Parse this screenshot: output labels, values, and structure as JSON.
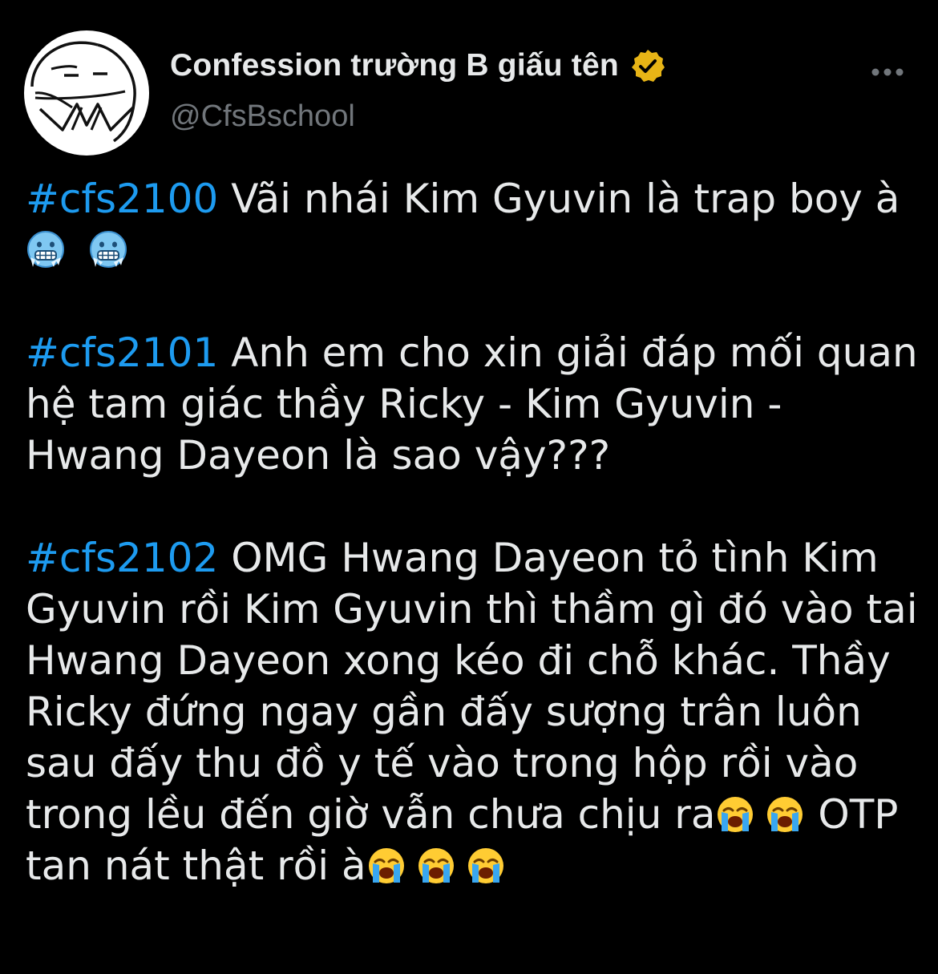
{
  "account": {
    "display_name": "Confession trường B giấu tên",
    "handle": "@CfsBschool",
    "verified_color": "#e7b416"
  },
  "tweet": {
    "posts": [
      {
        "tag": "#cfs2100",
        "text": "  Vãi nhái Kim Gyuvin là trap boy à",
        "emojis": [
          "cold-face",
          "cold-face"
        ]
      },
      {
        "tag": "#cfs2101",
        "text": "  Anh em cho xin giải đáp mối quan hệ tam giác thầy Ricky - Kim Gyuvin - Hwang Dayeon là sao vậy???"
      },
      {
        "tag": "#cfs2102",
        "text": "  OMG Hwang Dayeon tỏ tình Kim Gyuvin rồi Kim Gyuvin thì thầm gì đó vào tai Hwang Dayeon xong kéo đi chỗ khác. Thầy Ricky đứng ngay gần đấy sượng trân luôn sau đấy thu đồ y tế vào trong hộp rồi vào trong lều đến giờ vẫn chưa chịu ra",
        "middle_text": "  OTP tan nát thật rồi à",
        "emojis_a": [
          "loudly-crying-face",
          "loudly-crying-face"
        ],
        "emojis_b": [
          "loudly-crying-face",
          "loudly-crying-face",
          "loudly-crying-face"
        ]
      }
    ]
  },
  "colors": {
    "background": "#000000",
    "text": "#e7e9ea",
    "hashtag": "#1d9bf0",
    "secondary": "#71767b"
  }
}
